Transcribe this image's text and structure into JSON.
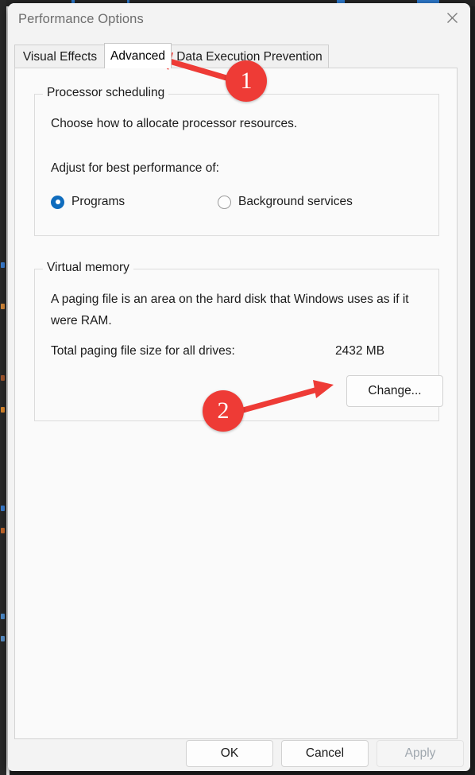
{
  "window": {
    "title": "Performance Options",
    "close_icon": "close-icon"
  },
  "tabs": [
    {
      "label": "Visual Effects",
      "active": false
    },
    {
      "label": "Advanced",
      "active": true
    },
    {
      "label": "Data Execution Prevention",
      "active": false
    }
  ],
  "processor_scheduling": {
    "group_label": "Processor scheduling",
    "description": "Choose how to allocate processor resources.",
    "prompt": "Adjust for best performance of:",
    "options": [
      {
        "label": "Programs",
        "selected": true
      },
      {
        "label": "Background services",
        "selected": false
      }
    ]
  },
  "virtual_memory": {
    "group_label": "Virtual memory",
    "description": "A paging file is an area on the hard disk that Windows uses as if it were RAM.",
    "total_label": "Total paging file size for all drives:",
    "total_value": "2432 MB",
    "change_button": "Change..."
  },
  "footer": {
    "ok": "OK",
    "cancel": "Cancel",
    "apply": "Apply",
    "apply_disabled": true
  },
  "annotations": [
    {
      "number": "1",
      "color": "#ee3b36"
    },
    {
      "number": "2",
      "color": "#ee3b36"
    }
  ],
  "colors": {
    "accent": "#0f6cbd",
    "annotation_red": "#ee3b36",
    "dialog_bg": "#f3f3f3",
    "panel_bg": "#fafafa",
    "title_text": "#6d6d6d"
  }
}
